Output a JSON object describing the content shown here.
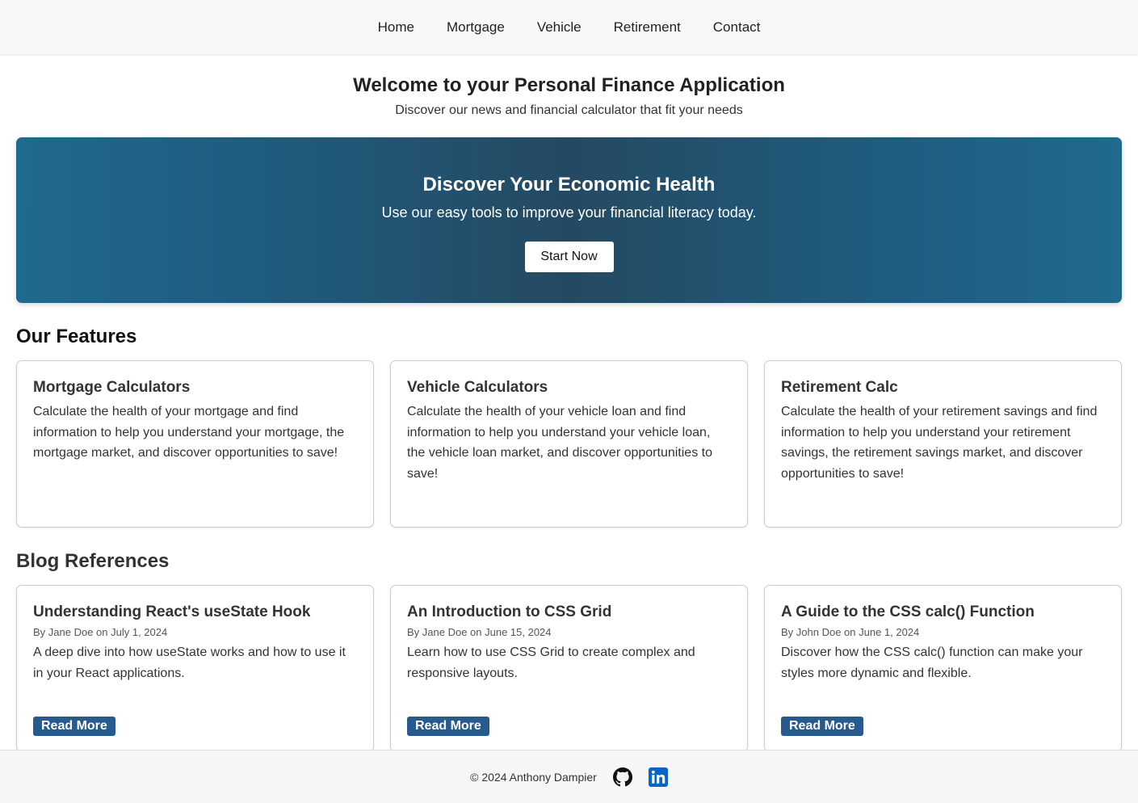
{
  "nav": {
    "items": [
      {
        "label": "Home"
      },
      {
        "label": "Mortgage"
      },
      {
        "label": "Vehicle"
      },
      {
        "label": "Retirement"
      },
      {
        "label": "Contact"
      }
    ]
  },
  "welcome": {
    "title": "Welcome to your Personal Finance Application",
    "subtitle": "Discover our news and financial calculator that fit your needs"
  },
  "hero": {
    "title": "Discover Your Economic Health",
    "subtitle": "Use our easy tools to improve your financial literacy today.",
    "button": "Start Now"
  },
  "features": {
    "title": "Our Features",
    "items": [
      {
        "title": "Mortgage Calculators",
        "desc": "Calculate the health of your mortgage and find information to help you understand your mortgage, the mortgage market, and discover opportunities to save!"
      },
      {
        "title": "Vehicle Calculators",
        "desc": "Calculate the health of your vehicle loan and find information to help you understand your vehicle loan, the vehicle loan market, and discover opportunities to save!"
      },
      {
        "title": "Retirement Calc",
        "desc": "Calculate the health of your retirement savings and find information to help you understand your retirement savings, the retirement savings market, and discover opportunities to save!"
      }
    ]
  },
  "blog": {
    "title": "Blog References",
    "read_more": "Read More",
    "items": [
      {
        "title": "Understanding React's useState Hook",
        "meta": "By Jane Doe on July 1, 2024",
        "desc": "A deep dive into how useState works and how to use it in your React applications."
      },
      {
        "title": "An Introduction to CSS Grid",
        "meta": "By Jane Doe on June 15, 2024",
        "desc": "Learn how to use CSS Grid to create complex and responsive layouts."
      },
      {
        "title": "A Guide to the CSS calc() Function",
        "meta": "By John Doe on June 1, 2024",
        "desc": "Discover how the CSS calc() function can make your styles more dynamic and flexible."
      }
    ]
  },
  "footer": {
    "copyright": "© 2024 Anthony Dampier",
    "icons": [
      "github-icon",
      "linkedin-icon"
    ]
  },
  "colors": {
    "hero_gradient": [
      "#1f6a8e",
      "#244a62"
    ],
    "read_more_bg": "#275a8f",
    "linkedin": "#0a66c2"
  }
}
